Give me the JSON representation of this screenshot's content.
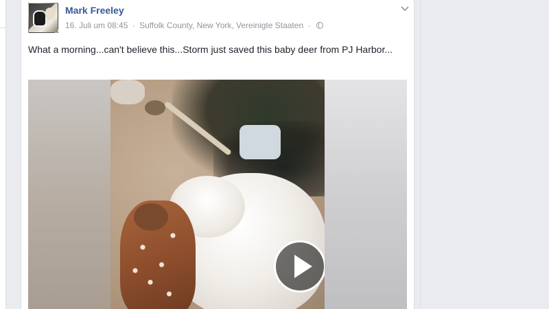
{
  "post": {
    "author": "Mark Freeley",
    "date": "16. Juli um 08:45",
    "location": "Suffolk County, New York, Vereinigte Staaten",
    "separator": "·",
    "text": "What a morning...can't believe this...Storm just saved this baby deer from PJ Harbor..."
  },
  "icons": {
    "options": "chevron-down-icon",
    "audience": "globe-icon",
    "video": "play-icon"
  },
  "colors": {
    "link": "#365899",
    "meta": "#90949c",
    "text": "#1d2129",
    "page_bg": "#e9ebee"
  }
}
